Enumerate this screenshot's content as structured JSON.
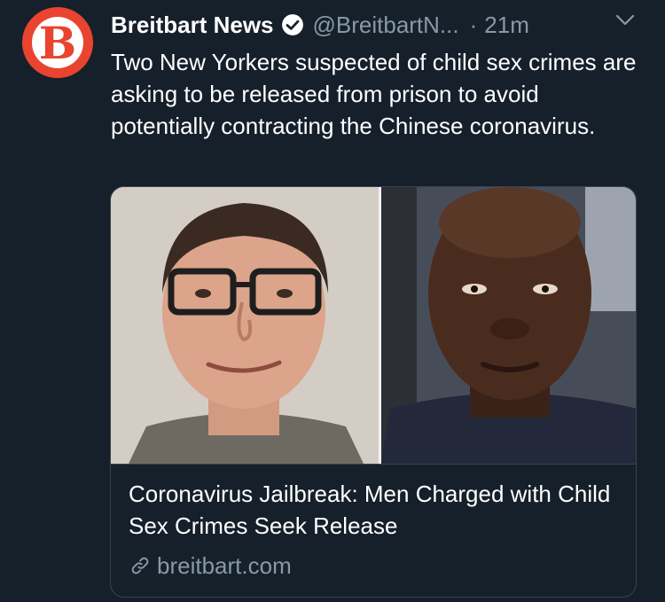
{
  "tweet": {
    "avatar_letter": "B",
    "author_name": "Breitbart News",
    "handle": "@BreitbartN...",
    "separator": "·",
    "time": "21m",
    "text": "Two New Yorkers suspected of child sex crimes are asking to be released from prison to avoid potentially contracting the Chinese coronavirus."
  },
  "card": {
    "title": "Coronavirus Jailbreak: Men Charged with Child Sex Crimes Seek Release",
    "domain": "breitbart.com"
  },
  "icons": {
    "verified": "verified-badge-icon",
    "caret": "chevron-down-icon",
    "link": "link-icon"
  },
  "colors": {
    "background": "#15202b",
    "secondary_text": "#8899a6",
    "border": "#38444d",
    "brand": "#e8442f"
  }
}
